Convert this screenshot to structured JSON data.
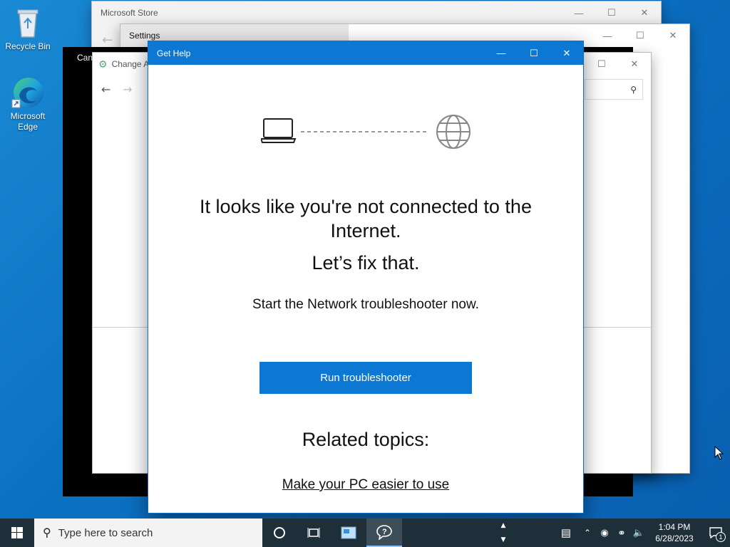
{
  "desktop": {
    "icons": [
      {
        "label": "Recycle Bin"
      },
      {
        "label": "Microsoft Edge"
      }
    ]
  },
  "windows": {
    "store_title": "Microsoft Store",
    "settings_title": "Settings",
    "change_title": "Change A",
    "black_title": "Can"
  },
  "gethelp": {
    "title": "Get Help",
    "headline": "It looks like you're not connected to the Internet.",
    "subheadline": "Let’s fix that.",
    "instruction": "Start the Network troubleshooter now.",
    "run_button": "Run troubleshooter",
    "related_heading": "Related topics:",
    "related_link": "Make your PC easier to use"
  },
  "taskbar": {
    "search_placeholder": "Type here to search",
    "time": "1:04 PM",
    "date": "6/28/2023",
    "notification_count": "1"
  },
  "colors": {
    "accent": "#0c78d4",
    "taskbar": "#1f2f3a"
  }
}
